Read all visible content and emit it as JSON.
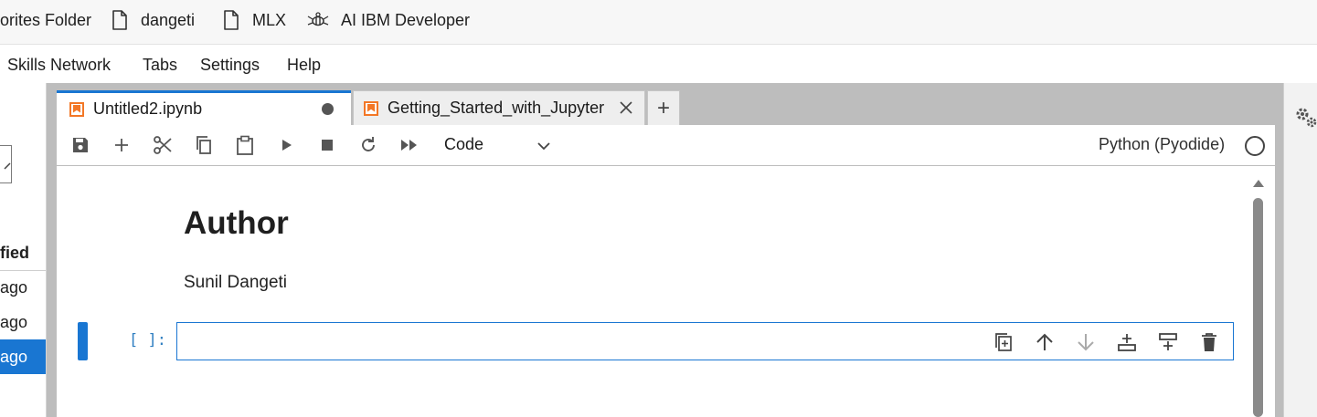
{
  "bookmarks": [
    {
      "label": "orites Folder",
      "icon": "folder-icon"
    },
    {
      "label": "dangeti",
      "icon": "page-icon"
    },
    {
      "label": "MLX",
      "icon": "page-icon"
    },
    {
      "label": "AI IBM Developer",
      "icon": "bee-icon"
    }
  ],
  "menu": [
    "Skills Network",
    "Tabs",
    "Settings",
    "Help"
  ],
  "file_browser": {
    "column_header": "fied",
    "rows": [
      "ago",
      "ago",
      "ago"
    ],
    "selected_row": 2
  },
  "tabs": [
    {
      "label": "Untitled2.ipynb",
      "status": "unsaved-dot",
      "active": true
    },
    {
      "label": "Getting_Started_with_Jupyter",
      "status": "close",
      "active": false
    }
  ],
  "new_tab_label": "+",
  "toolbar": {
    "buttons": [
      "save-icon",
      "add-cell-icon",
      "cut-icon",
      "copy-icon",
      "paste-icon",
      "run-icon",
      "stop-icon",
      "restart-icon",
      "run-all-icon"
    ],
    "cell_type": "Code",
    "kernel_name": "Python (Pyodide)",
    "kernel_status": "idle"
  },
  "notebook": {
    "heading": "Author",
    "author_name": "Sunil Dangeti",
    "code_prompt": "[ ]:",
    "cell_toolbar": [
      "duplicate-cell-icon",
      "move-up-icon",
      "move-down-icon",
      "insert-below-icon",
      "insert-above-icon",
      "delete-icon"
    ]
  },
  "colors": {
    "accent": "#1976d2",
    "jupyter_orange": "#f37726",
    "prompt_blue": "#307fc1"
  }
}
